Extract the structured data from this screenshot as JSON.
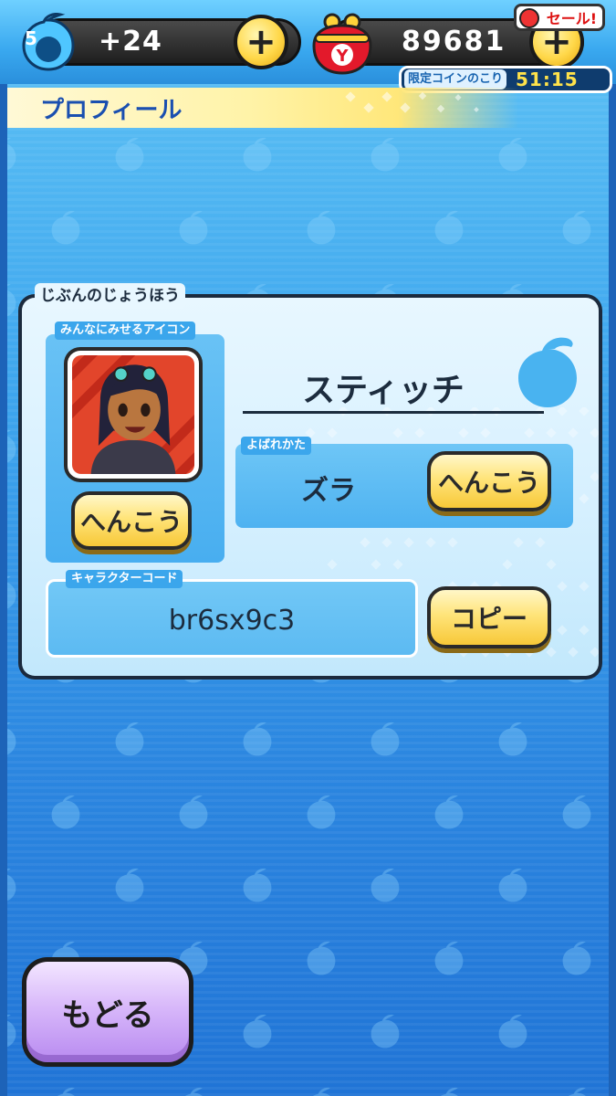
{
  "topbar": {
    "level": "5",
    "stamina": "+24",
    "coins": "89681",
    "plus_label": "+",
    "sale_label": "セール!",
    "limited_label": "限定コインのこり",
    "limited_time": "51:15"
  },
  "header": {
    "title": "プロフィール"
  },
  "profile": {
    "section_label": "じぶんのじょうほう",
    "icon_label": "みんなにみせるアイコン",
    "icon_change_button": "へんこう",
    "name": "スティッチ",
    "nickname_label": "よばれかた",
    "nickname": "ズラ",
    "nickname_change_button": "へんこう",
    "code_label": "キャラクターコード",
    "code": "br6sx9c3",
    "copy_button": "コピー"
  },
  "footer": {
    "back_button": "もどる"
  },
  "colors": {
    "accent_yellow": "#ffe47a",
    "back_purple": "#d8b8fa",
    "bg_blue": "#3ea6ee"
  }
}
